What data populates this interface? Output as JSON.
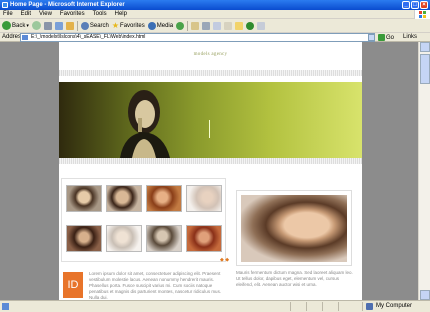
{
  "window": {
    "title": "Home Page - Microsoft Internet Explorer"
  },
  "menubar": {
    "items": [
      "File",
      "Edit",
      "View",
      "Favorites",
      "Tools",
      "Help"
    ]
  },
  "toolbar": {
    "back_label": "Back",
    "search_label": "Search",
    "favorites_label": "Favorites",
    "media_label": "Media"
  },
  "address": {
    "label": "Address",
    "value": "E:\\_\\modelxt\\lslcons\\4\\_sEASE\\_FL\\Web\\index.html",
    "go_label": "Go",
    "links_label": "Links"
  },
  "site": {
    "logo_text": "models agency",
    "id_badge": "ID",
    "body_text": "Lorem ipsum dolor sit amet, consectetuer adipiscing elit. Praesent vestibulum molestie lacus. Aenean nonummy hendrerit mauris. Phasellus porta. Fusce suscipit varius mi. Cum sociis natoque penatibus et magnis dis parturient montes, nascetur ridiculus mus. Nulla dui.",
    "right_text": "Mauris fermentum dictum magna. Sed laoreet aliquam leo. Ut tellus dolor, dapibus eget, elementum vel, cursus eleifend, elit. Aenean auctor wisi et urna.",
    "thumbs_dots": "◆ ◆"
  },
  "statusbar": {
    "zone_label": "My Computer"
  },
  "colors": {
    "title_bar": "#0a4ccf",
    "accent_orange": "#e8742a",
    "banner_green": "#8a9a2c"
  }
}
